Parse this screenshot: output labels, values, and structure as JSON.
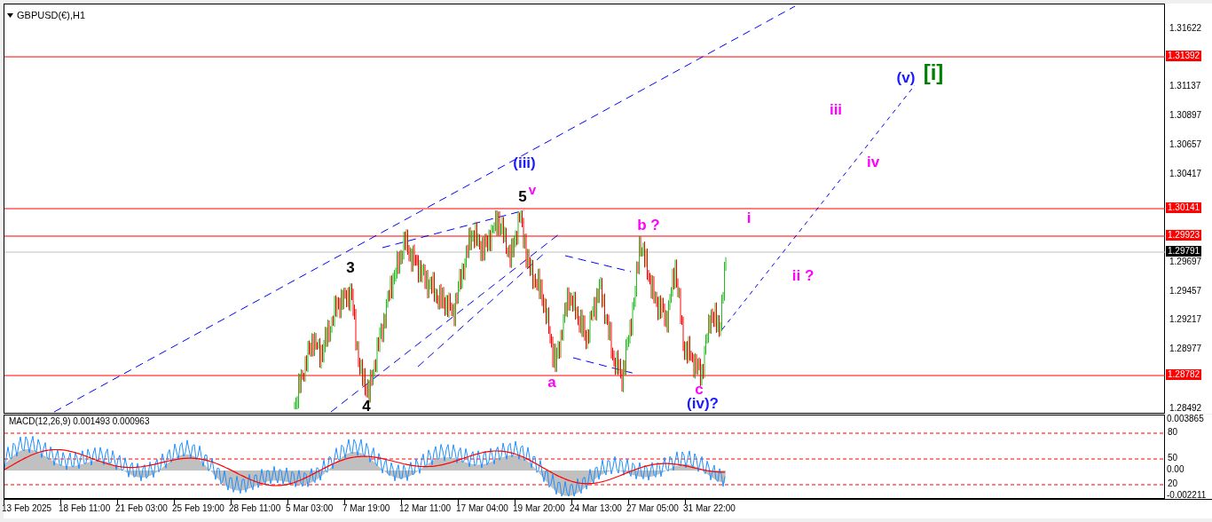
{
  "chart": {
    "symbol_label": "GBPUSD(€),H1",
    "axis_ticks": [
      "1.31622",
      "1.31137",
      "1.30897",
      "1.30657",
      "1.30417",
      "1.29697",
      "1.29457",
      "1.29217",
      "1.28977",
      "1.28492"
    ],
    "levels": [
      {
        "price": "1.31392",
        "kind": "level"
      },
      {
        "price": "1.30141",
        "kind": "level"
      },
      {
        "price": "1.29923",
        "kind": "level"
      },
      {
        "price": "1.29791",
        "kind": "current"
      },
      {
        "price": "1.28782",
        "kind": "level"
      }
    ],
    "wave_labels": [
      {
        "text": "3",
        "color": "#000000"
      },
      {
        "text": "4",
        "color": "#000000"
      },
      {
        "text": "(iii)",
        "color": "#1a1aff"
      },
      {
        "text": "5",
        "color": "#000000"
      },
      {
        "text": "v",
        "color": "#ff00ff"
      },
      {
        "text": "b ?",
        "color": "#ff00ff"
      },
      {
        "text": "i",
        "color": "#ff00ff"
      },
      {
        "text": "a",
        "color": "#ff00ff"
      },
      {
        "text": "c",
        "color": "#ff00ff"
      },
      {
        "text": "(iv)?",
        "color": "#1a1aff"
      },
      {
        "text": "iii",
        "color": "#ff00ff"
      },
      {
        "text": "iv",
        "color": "#ff00ff"
      },
      {
        "text": "ii ?",
        "color": "#ff00ff"
      },
      {
        "text": "(v)",
        "color": "#1a1aff"
      },
      {
        "text": "[i]",
        "color": "#008000"
      }
    ]
  },
  "macd": {
    "title": "MACD(12,26,9) 0.001493 0.000963",
    "axis_labels": [
      {
        "text": "0.003865",
        "kind": "value"
      },
      {
        "text": "80",
        "kind": "level"
      },
      {
        "text": "50",
        "kind": "level"
      },
      {
        "text": "0.00",
        "kind": "value"
      },
      {
        "text": "20",
        "kind": "level"
      },
      {
        "text": "-0.002211",
        "kind": "value"
      }
    ]
  },
  "time_axis": [
    "13 Feb 2025",
    "18 Feb 11:00",
    "21 Feb 03:00",
    "25 Feb 19:00",
    "28 Feb 11:00",
    "5 Mar 03:00",
    "7 Mar 19:00",
    "12 Mar 11:00",
    "17 Mar 04:00",
    "19 Mar 20:00",
    "24 Mar 13:00",
    "27 Mar 05:00",
    "31 Mar 22:00"
  ]
}
